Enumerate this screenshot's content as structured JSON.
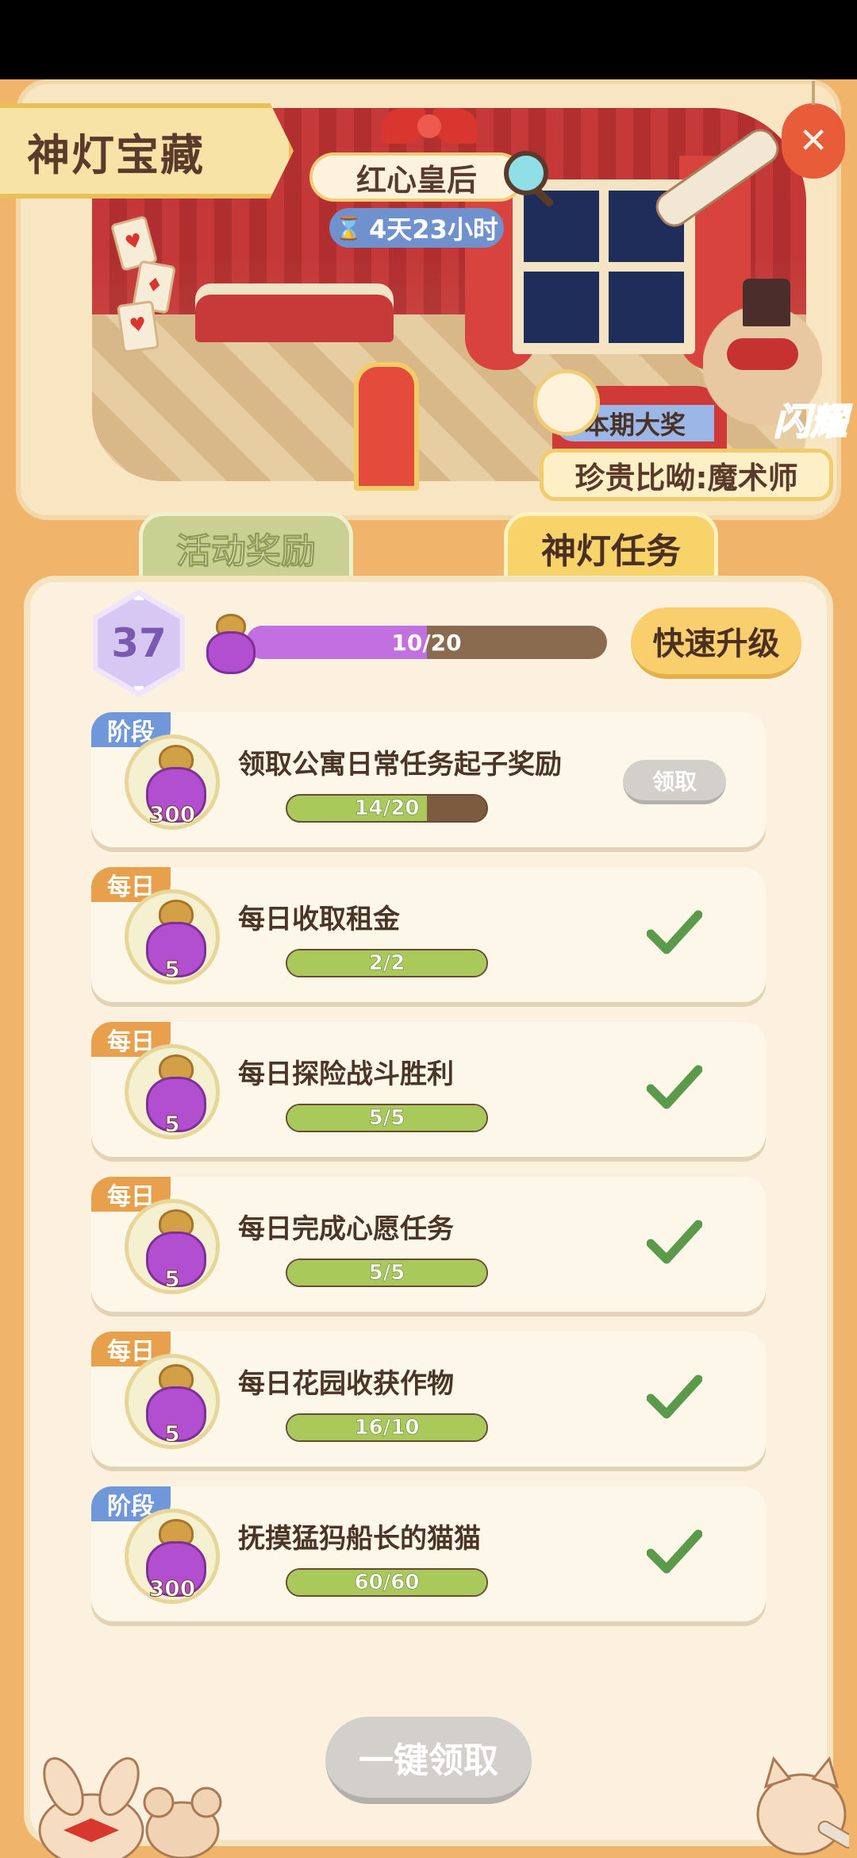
{
  "banner": {
    "title": "神灯宝藏",
    "theme_name": "红心皇后",
    "timer": "4天23小时",
    "prize_label": "本期大奖",
    "prize_name": "珍贵比呦:魔术师",
    "shine_tag": "闪耀",
    "close_icon": "close-icon"
  },
  "tabs": [
    {
      "label": "活动奖励",
      "active": false
    },
    {
      "label": "神灯任务",
      "active": true
    }
  ],
  "progress": {
    "level": "37",
    "exp_text": "10/20",
    "exp_fraction": 0.5,
    "quick_upgrade_label": "快速升级"
  },
  "tasks": [
    {
      "tag": "阶段",
      "tag_type": "stage",
      "reward": "300",
      "title": "领取公寓日常任务起子奖励",
      "progress_text": "14/20",
      "fraction": 0.7,
      "action": "领取",
      "done": false
    },
    {
      "tag": "每日",
      "tag_type": "daily",
      "reward": "5",
      "title": "每日收取租金",
      "progress_text": "2/2",
      "fraction": 1.0,
      "done": true
    },
    {
      "tag": "每日",
      "tag_type": "daily",
      "reward": "5",
      "title": "每日探险战斗胜利",
      "progress_text": "5/5",
      "fraction": 1.0,
      "done": true
    },
    {
      "tag": "每日",
      "tag_type": "daily",
      "reward": "5",
      "title": "每日完成心愿任务",
      "progress_text": "5/5",
      "fraction": 1.0,
      "done": true
    },
    {
      "tag": "每日",
      "tag_type": "daily",
      "reward": "5",
      "title": "每日花园收获作物",
      "progress_text": "16/10",
      "fraction": 1.0,
      "done": true
    },
    {
      "tag": "阶段",
      "tag_type": "stage",
      "reward": "300",
      "title": "抚摸猛犸船长的猫猫",
      "progress_text": "60/60",
      "fraction": 1.0,
      "done": true
    }
  ],
  "claim_all_label": "一键领取",
  "colors": {
    "background": "#f0b46b",
    "panel": "#fbf1de",
    "stage_tag": "#6f97d9",
    "daily_tag": "#e8a04c",
    "progress_green": "#a9c95a",
    "exp_purple": "#c26fe0",
    "quick_button": "#f8cf6c",
    "disabled_button": "#d3d0cb",
    "check_green": "#5a9a4a"
  }
}
